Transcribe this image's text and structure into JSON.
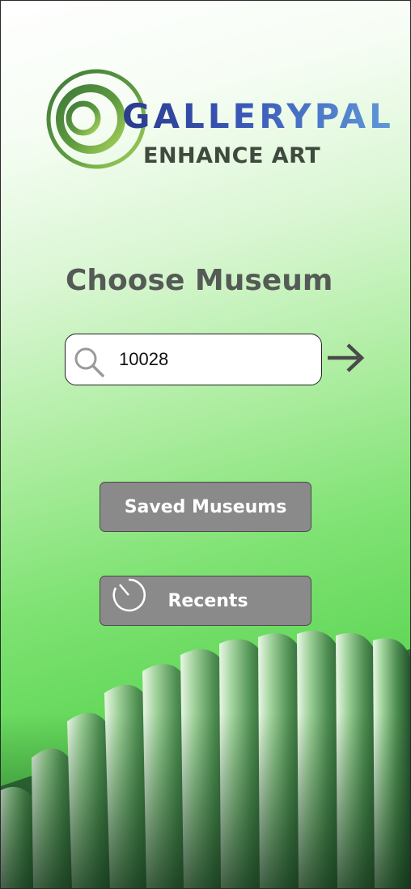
{
  "brand": {
    "name": "GALLERYPAL",
    "tagline": "ENHANCE ART",
    "logo_icon": "concentric-circles-logo",
    "colors": {
      "ring_dark": "#3f7a3a",
      "ring_light": "#9ccd5a",
      "text_start": "#2b3b8e",
      "text_end": "#5f9ad9"
    }
  },
  "main": {
    "title": "Choose Museum"
  },
  "search": {
    "value": "10028",
    "icon": "search-icon",
    "submit_icon": "arrow-right-icon"
  },
  "buttons": {
    "saved_museums": "Saved Museums",
    "recents": "Recents",
    "recents_icon": "clock-icon"
  },
  "colors": {
    "button_bg": "#8a8a8a",
    "heading": "#565a56",
    "background_green": "#5ed655"
  }
}
